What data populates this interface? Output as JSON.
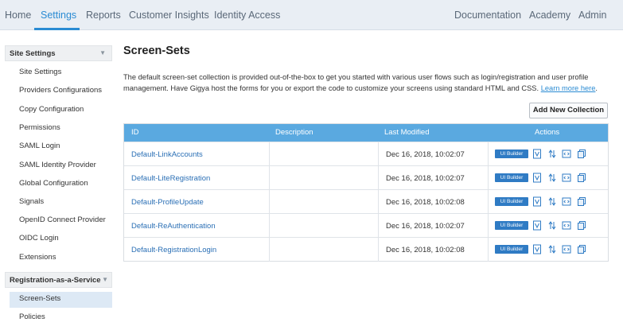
{
  "nav": {
    "left": [
      "Home",
      "Settings",
      "Reports",
      "Customer Insights",
      "Identity Access"
    ],
    "right": [
      "Documentation",
      "Academy",
      "Admin"
    ]
  },
  "sidebar": {
    "group1": "Site Settings",
    "items1": [
      "Site Settings",
      "Providers Configurations",
      "Copy Configuration",
      "Permissions",
      "SAML Login",
      "SAML Identity Provider",
      "Global Configuration",
      "Signals",
      "OpenID Connect Provider",
      "OIDC Login",
      "Extensions"
    ],
    "group2": "Registration-as-a-Service",
    "items2": [
      "Screen-Sets",
      "Policies"
    ]
  },
  "main": {
    "title": "Screen-Sets",
    "desc_line1": "The default screen-set collection is provided out-of-the-box to get you started with various user flows such as login/registration and user profile",
    "desc_line2": "management. Have Gigya host the forms for you or export the code to customize your screens using standard HTML and CSS.",
    "learn_more": "Learn more here",
    "add_button": "Add New Collection"
  },
  "table": {
    "headers": [
      "ID",
      "Description",
      "Last Modified",
      "Actions"
    ],
    "ui_builder_label": "UI Builder",
    "rows": [
      {
        "id": "Default-LinkAccounts",
        "modified": "Dec 16, 2018, 10:02:07"
      },
      {
        "id": "Default-LiteRegistration",
        "modified": "Dec 16, 2018, 10:02:07"
      },
      {
        "id": "Default-ProfileUpdate",
        "modified": "Dec 16, 2018, 10:02:08"
      },
      {
        "id": "Default-ReAuthentication",
        "modified": "Dec 16, 2018, 10:02:07"
      },
      {
        "id": "Default-RegistrationLogin",
        "modified": "Dec 16, 2018, 10:02:08"
      }
    ]
  },
  "colors": {
    "accent": "#2a8bd3",
    "table_header": "#5aa9e0",
    "ui_builder": "#2f7bc4",
    "selected_item": "#dde9f5"
  },
  "icons": [
    "version-icon",
    "sync-icon",
    "code-icon",
    "copy-icon"
  ]
}
